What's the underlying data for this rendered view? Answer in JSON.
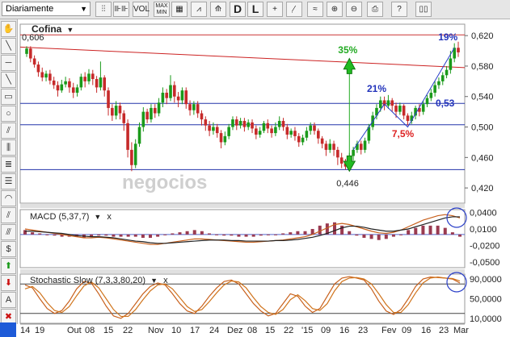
{
  "toolbar": {
    "period": "Diariamente",
    "buttons": [
      {
        "name": "toolbar-button-chart-type",
        "icon": "bar-chart-icon",
        "text": "⫶⫶"
      },
      {
        "name": "toolbar-button-candles",
        "icon": "candlestick-icon",
        "text": "⊪⊪"
      },
      {
        "name": "toolbar-button-vol",
        "icon": "volume-icon",
        "text": "VOL"
      },
      {
        "name": "toolbar-button-max-min",
        "icon": "max-min-icon",
        "text": "MAX MIN"
      },
      {
        "name": "toolbar-button-grid",
        "icon": "grid-icon",
        "text": "▦"
      },
      {
        "name": "toolbar-button-indicators",
        "icon": "indicator-chart-icon",
        "text": "⩘"
      },
      {
        "name": "toolbar-button-compare",
        "icon": "compare-icon",
        "text": "⟰"
      },
      {
        "name": "toolbar-button-daily",
        "icon": "letter-d-icon",
        "text": "D"
      },
      {
        "name": "toolbar-button-log",
        "icon": "letter-l-icon",
        "text": "L"
      },
      {
        "name": "toolbar-button-crosshair",
        "icon": "crosshair-icon",
        "text": "+"
      },
      {
        "name": "toolbar-button-cursor",
        "icon": "cursor-icon",
        "text": "⁄̣"
      },
      {
        "name": "toolbar-button-smooth",
        "icon": "wave-icon",
        "text": "≈"
      },
      {
        "name": "toolbar-button-zoom-in",
        "icon": "zoom-in-icon",
        "text": "⊕"
      },
      {
        "name": "toolbar-button-zoom-out",
        "icon": "zoom-out-icon",
        "text": "⊖"
      },
      {
        "name": "toolbar-button-print",
        "icon": "print-icon",
        "text": "⎙"
      },
      {
        "name": "toolbar-button-help",
        "icon": "help-icon",
        "text": "?"
      },
      {
        "name": "toolbar-button-book",
        "icon": "book-icon",
        "text": "▯▯"
      }
    ]
  },
  "sidebar": {
    "tools": [
      {
        "name": "hand-tool-icon",
        "text": "✋"
      },
      {
        "name": "line-tool-icon",
        "text": "╲"
      },
      {
        "name": "horizontal-line-tool-icon",
        "text": "─"
      },
      {
        "name": "diagonal-line-tool-icon",
        "text": "╲"
      },
      {
        "name": "rectangle-tool-icon",
        "text": "▭"
      },
      {
        "name": "circle-tool-icon",
        "text": "○"
      },
      {
        "name": "channel-tool-icon",
        "text": "⫽"
      },
      {
        "name": "fibonacci-fan-tool-icon",
        "text": "⫼"
      },
      {
        "name": "fibonacci-retracement-tool-icon",
        "text": "≣"
      },
      {
        "name": "fibonacci-lines-tool-icon",
        "text": "☰"
      },
      {
        "name": "arc-tool-icon",
        "text": "◠"
      },
      {
        "name": "parallel-lines-tool-icon",
        "text": "⫽"
      },
      {
        "name": "speed-lines-tool-icon",
        "text": "⫻"
      },
      {
        "name": "dollar-tool-icon",
        "text": "$"
      },
      {
        "name": "buy-arrow-tool-icon",
        "text": "⬆"
      },
      {
        "name": "sell-arrow-tool-icon",
        "text": "⬇"
      },
      {
        "name": "text-tool-icon",
        "text": "A"
      },
      {
        "name": "delete-tool-icon",
        "text": "✖"
      }
    ]
  },
  "chart_data": {
    "type": "candlestick",
    "symbol": "Cofina",
    "price_panel": {
      "ylim": [
        0.4,
        0.635
      ],
      "yticks": [
        0.42,
        0.46,
        0.5,
        0.54,
        0.58,
        0.62
      ],
      "ytick_labels": [
        "0,420",
        "0,460",
        "0,500",
        "0,540",
        "0,580",
        "0,620"
      ],
      "max_label": "0,606",
      "min_label": "0,446",
      "horizontal_lines": [
        {
          "value": 0.621,
          "color": "#cc3333"
        },
        {
          "value": 0.531,
          "color": "#2233aa"
        },
        {
          "value": 0.503,
          "color": "#2233aa"
        },
        {
          "value": 0.444,
          "color": "#2233aa"
        }
      ],
      "annotations": [
        {
          "text": "35%",
          "color": "#22aa22"
        },
        {
          "text": "21%",
          "color": "#2233bb"
        },
        {
          "text": "19%",
          "color": "#2233bb"
        },
        {
          "text": "0,53",
          "color": "#2233bb"
        },
        {
          "text": "7,5%",
          "color": "#dd2222"
        }
      ],
      "watermark": "negocios",
      "candles": [
        [
          0.596,
          0.603,
          0.592,
          0.606
        ],
        [
          0.603,
          0.59,
          0.585,
          0.606
        ],
        [
          0.59,
          0.582,
          0.578,
          0.594
        ],
        [
          0.582,
          0.572,
          0.566,
          0.586
        ],
        [
          0.572,
          0.565,
          0.56,
          0.578
        ],
        [
          0.565,
          0.57,
          0.56,
          0.574
        ],
        [
          0.57,
          0.561,
          0.556,
          0.575
        ],
        [
          0.561,
          0.555,
          0.55,
          0.566
        ],
        [
          0.555,
          0.548,
          0.54,
          0.56
        ],
        [
          0.548,
          0.556,
          0.545,
          0.562
        ],
        [
          0.556,
          0.56,
          0.552,
          0.566
        ],
        [
          0.56,
          0.552,
          0.545,
          0.564
        ],
        [
          0.552,
          0.545,
          0.538,
          0.558
        ],
        [
          0.545,
          0.552,
          0.54,
          0.556
        ],
        [
          0.552,
          0.566,
          0.548,
          0.57
        ],
        [
          0.566,
          0.56,
          0.552,
          0.572
        ],
        [
          0.56,
          0.57,
          0.556,
          0.576
        ],
        [
          0.57,
          0.563,
          0.555,
          0.575
        ],
        [
          0.563,
          0.552,
          0.545,
          0.567
        ],
        [
          0.552,
          0.565,
          0.548,
          0.586
        ],
        [
          0.565,
          0.548,
          0.54,
          0.568
        ],
        [
          0.548,
          0.525,
          0.515,
          0.552
        ],
        [
          0.525,
          0.515,
          0.508,
          0.53
        ],
        [
          0.515,
          0.528,
          0.51,
          0.534
        ],
        [
          0.528,
          0.518,
          0.51,
          0.532
        ],
        [
          0.518,
          0.505,
          0.495,
          0.522
        ],
        [
          0.505,
          0.47,
          0.46,
          0.51
        ],
        [
          0.47,
          0.45,
          0.442,
          0.48
        ],
        [
          0.45,
          0.478,
          0.446,
          0.484
        ],
        [
          0.478,
          0.5,
          0.474,
          0.506
        ],
        [
          0.5,
          0.52,
          0.494,
          0.526
        ],
        [
          0.52,
          0.51,
          0.505,
          0.524
        ],
        [
          0.51,
          0.525,
          0.506,
          0.53
        ],
        [
          0.525,
          0.518,
          0.512,
          0.53
        ],
        [
          0.518,
          0.532,
          0.514,
          0.538
        ],
        [
          0.532,
          0.545,
          0.526,
          0.552
        ],
        [
          0.545,
          0.538,
          0.53,
          0.55
        ],
        [
          0.538,
          0.555,
          0.534,
          0.568
        ],
        [
          0.555,
          0.54,
          0.532,
          0.56
        ],
        [
          0.54,
          0.535,
          0.526,
          0.546
        ],
        [
          0.535,
          0.548,
          0.53,
          0.552
        ],
        [
          0.548,
          0.53,
          0.524,
          0.552
        ],
        [
          0.53,
          0.522,
          0.515,
          0.535
        ],
        [
          0.522,
          0.53,
          0.516,
          0.534
        ],
        [
          0.53,
          0.518,
          0.512,
          0.534
        ],
        [
          0.518,
          0.51,
          0.502,
          0.522
        ],
        [
          0.51,
          0.502,
          0.495,
          0.514
        ],
        [
          0.502,
          0.495,
          0.488,
          0.508
        ],
        [
          0.495,
          0.5,
          0.49,
          0.506
        ],
        [
          0.5,
          0.492,
          0.486,
          0.504
        ],
        [
          0.492,
          0.48,
          0.472,
          0.496
        ],
        [
          0.48,
          0.488,
          0.476,
          0.494
        ],
        [
          0.488,
          0.5,
          0.484,
          0.504
        ],
        [
          0.5,
          0.51,
          0.496,
          0.514
        ],
        [
          0.51,
          0.502,
          0.496,
          0.514
        ],
        [
          0.502,
          0.508,
          0.498,
          0.512
        ],
        [
          0.508,
          0.5,
          0.494,
          0.512
        ],
        [
          0.5,
          0.506,
          0.496,
          0.51
        ],
        [
          0.506,
          0.498,
          0.492,
          0.51
        ],
        [
          0.498,
          0.49,
          0.484,
          0.502
        ],
        [
          0.49,
          0.495,
          0.486,
          0.5
        ],
        [
          0.495,
          0.505,
          0.492,
          0.508
        ],
        [
          0.505,
          0.498,
          0.492,
          0.51
        ],
        [
          0.498,
          0.492,
          0.486,
          0.502
        ],
        [
          0.492,
          0.5,
          0.488,
          0.506
        ],
        [
          0.5,
          0.508,
          0.496,
          0.514
        ],
        [
          0.508,
          0.5,
          0.495,
          0.512
        ],
        [
          0.5,
          0.49,
          0.484,
          0.504
        ],
        [
          0.49,
          0.495,
          0.486,
          0.498
        ],
        [
          0.495,
          0.488,
          0.482,
          0.5
        ],
        [
          0.488,
          0.48,
          0.474,
          0.492
        ],
        [
          0.48,
          0.486,
          0.476,
          0.49
        ],
        [
          0.486,
          0.495,
          0.482,
          0.5
        ],
        [
          0.495,
          0.502,
          0.49,
          0.506
        ],
        [
          0.502,
          0.495,
          0.49,
          0.506
        ],
        [
          0.495,
          0.485,
          0.478,
          0.498
        ],
        [
          0.485,
          0.478,
          0.472,
          0.488
        ],
        [
          0.478,
          0.47,
          0.462,
          0.482
        ],
        [
          0.47,
          0.478,
          0.466,
          0.484
        ],
        [
          0.478,
          0.47,
          0.462,
          0.482
        ],
        [
          0.47,
          0.46,
          0.45,
          0.474
        ],
        [
          0.46,
          0.452,
          0.446,
          0.466
        ],
        [
          0.452,
          0.448,
          0.444,
          0.458
        ],
        [
          0.448,
          0.462,
          0.446,
          0.466
        ],
        [
          0.462,
          0.47,
          0.456,
          0.474
        ],
        [
          0.47,
          0.478,
          0.466,
          0.482
        ],
        [
          0.478,
          0.47,
          0.464,
          0.482
        ],
        [
          0.47,
          0.482,
          0.466,
          0.486
        ],
        [
          0.482,
          0.5,
          0.478,
          0.504
        ],
        [
          0.5,
          0.515,
          0.496,
          0.52
        ],
        [
          0.515,
          0.525,
          0.51,
          0.53
        ],
        [
          0.525,
          0.535,
          0.52,
          0.54
        ],
        [
          0.535,
          0.528,
          0.522,
          0.54
        ],
        [
          0.528,
          0.535,
          0.524,
          0.542
        ],
        [
          0.535,
          0.528,
          0.52,
          0.538
        ],
        [
          0.528,
          0.52,
          0.512,
          0.532
        ],
        [
          0.52,
          0.528,
          0.516,
          0.532
        ],
        [
          0.528,
          0.515,
          0.51,
          0.53
        ],
        [
          0.515,
          0.508,
          0.502,
          0.518
        ],
        [
          0.508,
          0.515,
          0.504,
          0.52
        ],
        [
          0.515,
          0.525,
          0.51,
          0.528
        ],
        [
          0.525,
          0.52,
          0.514,
          0.53
        ],
        [
          0.52,
          0.53,
          0.516,
          0.534
        ],
        [
          0.53,
          0.538,
          0.526,
          0.542
        ],
        [
          0.538,
          0.545,
          0.534,
          0.55
        ],
        [
          0.545,
          0.555,
          0.54,
          0.56
        ],
        [
          0.555,
          0.56,
          0.55,
          0.565
        ],
        [
          0.56,
          0.568,
          0.555,
          0.572
        ],
        [
          0.568,
          0.575,
          0.564,
          0.58
        ],
        [
          0.575,
          0.59,
          0.57,
          0.6
        ],
        [
          0.59,
          0.604,
          0.585,
          0.61
        ],
        [
          0.604,
          0.598,
          0.592,
          0.612
        ]
      ]
    },
    "macd_panel": {
      "label": "MACD (5,37,7)",
      "ylim": [
        -0.06,
        0.045
      ],
      "yticks": [
        0.04,
        0.01,
        -0.02,
        -0.05
      ],
      "ytick_labels": [
        "0,0400",
        "0,0100",
        "-0,0200",
        "-0,0500"
      ],
      "lines": [
        {
          "color": "#c8601c",
          "values": [
            0.01,
            0.008,
            0.006,
            0.004,
            0.002,
            0.0,
            -0.002,
            -0.004,
            -0.006,
            -0.006,
            -0.005,
            -0.006,
            -0.008,
            -0.01,
            -0.012,
            -0.014,
            -0.016,
            -0.018,
            -0.018,
            -0.016,
            -0.014,
            -0.012,
            -0.01,
            -0.008,
            -0.008,
            -0.009,
            -0.01,
            -0.011,
            -0.012,
            -0.013,
            -0.014,
            -0.014,
            -0.013,
            -0.012,
            -0.011,
            -0.01,
            -0.008,
            -0.006,
            -0.004,
            0.0,
            0.006,
            0.012,
            0.018,
            0.02,
            0.018,
            0.014,
            0.01,
            0.006,
            0.003,
            0.002,
            0.004,
            0.008,
            0.014,
            0.02,
            0.026,
            0.03,
            0.034,
            0.036,
            0.034,
            0.03
          ]
        },
        {
          "color": "#222222",
          "values": [
            0.006,
            0.006,
            0.005,
            0.004,
            0.003,
            0.002,
            0.0,
            -0.002,
            -0.003,
            -0.004,
            -0.004,
            -0.005,
            -0.006,
            -0.008,
            -0.01,
            -0.012,
            -0.013,
            -0.015,
            -0.016,
            -0.016,
            -0.015,
            -0.014,
            -0.013,
            -0.012,
            -0.011,
            -0.01,
            -0.01,
            -0.01,
            -0.011,
            -0.011,
            -0.012,
            -0.012,
            -0.012,
            -0.012,
            -0.011,
            -0.011,
            -0.01,
            -0.009,
            -0.007,
            -0.005,
            -0.002,
            0.002,
            0.007,
            0.012,
            0.015,
            0.015,
            0.013,
            0.01,
            0.008,
            0.006,
            0.006,
            0.008,
            0.01,
            0.014,
            0.018,
            0.022,
            0.026,
            0.03,
            0.032,
            0.032
          ]
        }
      ]
    },
    "stochastic_panel": {
      "label": "Stochastic Slow (7,3,3,80,20)",
      "ylim": [
        0,
        100
      ],
      "yticks": [
        90,
        50,
        10
      ],
      "ytick_labels": [
        "90,0000",
        "50,0000",
        "10,0000"
      ],
      "reference_lines": [
        80,
        20
      ],
      "lines": [
        {
          "color": "#c8601c",
          "values": [
            78,
            72,
            50,
            30,
            20,
            26,
            45,
            70,
            85,
            82,
            60,
            35,
            15,
            10,
            20,
            40,
            60,
            75,
            82,
            78,
            60,
            40,
            25,
            20,
            35,
            55,
            72,
            85,
            88,
            80,
            60,
            40,
            25,
            15,
            20,
            40,
            60,
            55,
            35,
            22,
            30,
            55,
            80,
            92,
            95,
            92,
            88,
            70,
            45,
            25,
            18,
            28,
            50,
            75,
            90,
            94,
            93,
            92,
            90,
            82
          ]
        },
        {
          "color": "#d0741c",
          "values": [
            70,
            75,
            62,
            42,
            26,
            22,
            34,
            56,
            76,
            84,
            72,
            50,
            28,
            14,
            14,
            28,
            48,
            66,
            78,
            80,
            70,
            52,
            34,
            24,
            28,
            44,
            62,
            78,
            86,
            84,
            72,
            52,
            34,
            22,
            18,
            28,
            48,
            58,
            46,
            30,
            26,
            40,
            66,
            85,
            92,
            93,
            90,
            80,
            60,
            38,
            22,
            22,
            38,
            62,
            82,
            92,
            94,
            92,
            91,
            86
          ]
        }
      ]
    },
    "x_tick_labels": [
      "14",
      "19",
      "Out",
      "08",
      "15",
      "22",
      "Nov",
      "10",
      "17",
      "24",
      "Dez",
      "08",
      "15",
      "22",
      "'15",
      "09",
      "16",
      "23",
      "Fev",
      "09",
      "16",
      "23",
      "Mar"
    ]
  }
}
